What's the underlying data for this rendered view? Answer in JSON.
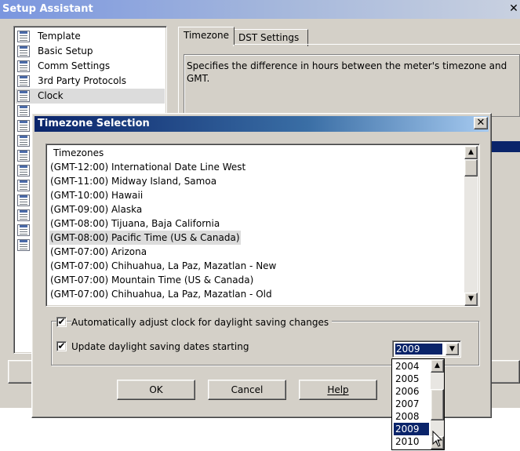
{
  "setup": {
    "title": "Setup Assistant",
    "close_glyph": "✕",
    "tree_items": [
      {
        "label": "Template",
        "selected": false
      },
      {
        "label": "Basic Setup",
        "selected": false
      },
      {
        "label": "Comm Settings",
        "selected": false
      },
      {
        "label": "3rd Party Protocols",
        "selected": false
      },
      {
        "label": "Clock",
        "selected": true
      }
    ],
    "tabs": [
      {
        "label": "Timezone",
        "active": true
      },
      {
        "label": "DST Settings",
        "active": false
      }
    ],
    "description": "Specifies the difference in hours between the meter's timezone and GMT."
  },
  "dialog": {
    "title": "Timezone Selection",
    "close_glyph": "✕",
    "list_header": "Timezones",
    "timezones": [
      {
        "label": "(GMT-12:00) International Date Line West",
        "selected": false
      },
      {
        "label": "(GMT-11:00) Midway Island, Samoa",
        "selected": false
      },
      {
        "label": "(GMT-10:00) Hawaii",
        "selected": false
      },
      {
        "label": "(GMT-09:00) Alaska",
        "selected": false
      },
      {
        "label": "(GMT-08:00) Tijuana, Baja California",
        "selected": false
      },
      {
        "label": "(GMT-08:00) Pacific Time (US & Canada)",
        "selected": true
      },
      {
        "label": "(GMT-07:00) Arizona",
        "selected": false
      },
      {
        "label": "(GMT-07:00) Chihuahua, La Paz, Mazatlan - New",
        "selected": false
      },
      {
        "label": "(GMT-07:00) Mountain Time (US & Canada)",
        "selected": false
      },
      {
        "label": "(GMT-07:00) Chihuahua, La Paz, Mazatlan - Old",
        "selected": false
      }
    ],
    "auto_adjust": {
      "label": "Automatically adjust clock for daylight saving changes",
      "checked": true
    },
    "update_dst": {
      "label": "Update daylight saving dates starting",
      "checked": true
    },
    "check_glyph": "✔",
    "year_selected": "2009",
    "year_options": [
      "2004",
      "2005",
      "2006",
      "2007",
      "2008",
      "2009",
      "2010"
    ],
    "buttons": {
      "ok": "OK",
      "cancel": "Cancel",
      "help": "Help"
    }
  },
  "icons": {
    "scroll_up": "▲",
    "scroll_down": "▼"
  },
  "colors": {
    "selection": "#0a246a",
    "face": "#d4d0c8",
    "list_highlight": "#dcdcdc"
  }
}
